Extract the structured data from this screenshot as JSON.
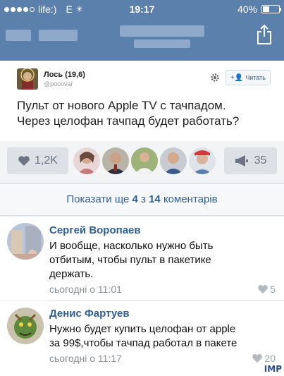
{
  "status_bar": {
    "carrier": "life:)",
    "network": "E",
    "time": "19:17",
    "battery": "40%",
    "battery_level": 0.4
  },
  "post": {
    "author": "Лось (19,6)",
    "handle": "@pooovar",
    "follow_label": "Читать",
    "text_line1": "Пульт от нового Apple TV с тачпадом.",
    "text_line2": "Через целофан тачпад будет работать?",
    "likes": "1,2K",
    "shares": "35"
  },
  "more_comments": {
    "prefix": "Показати ще ",
    "shown": "4",
    "mid": " з ",
    "total": "14",
    "suffix": " коментарів"
  },
  "comments": [
    {
      "name": "Сергей Воропаев",
      "line1": "И вообще, насколько нужно быть",
      "line2": "отбитым, чтобы пульт в пакетике",
      "line3": "держать.",
      "time": "сьогодні о 11:01",
      "likes": "5"
    },
    {
      "name": "Денис Фартуев",
      "line1": "Нужно будет купить целофан от apple",
      "line2": "за 99$,чтобы тачпад работал в пакете",
      "time": "сьогодні о 11:17",
      "likes": "20"
    }
  ],
  "watermark": "IMP",
  "colors": {
    "nav_bar": "#5b80ab",
    "link": "#2f5f93"
  },
  "icons": [
    "share-icon",
    "gear-icon",
    "heart-icon",
    "megaphone-icon"
  ]
}
